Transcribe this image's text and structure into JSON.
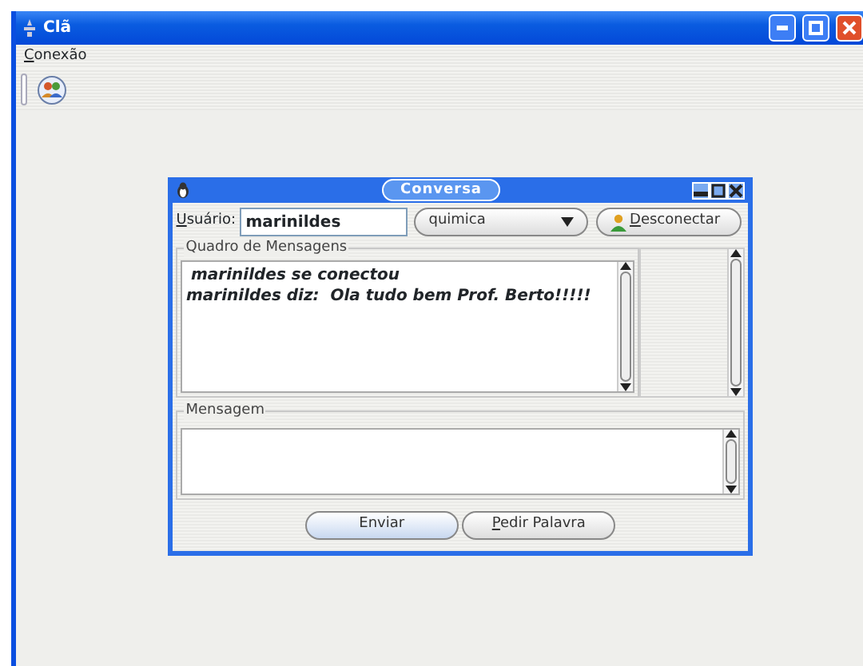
{
  "window": {
    "title": "Clã"
  },
  "menu": [
    "Conexão"
  ],
  "dialog": {
    "title": "Conversa",
    "user_label": "Usuário:",
    "user_value": "marinildes",
    "room": "quimica",
    "disconnect_button": "Desconectar",
    "messages_group": "Quadro de Mensagens",
    "messages": [
      "marinildes se conectou",
      "marinildes diz:  Ola tudo bem Prof. Berto!!!!!"
    ],
    "input_group": "Mensagem",
    "buttons": [
      "Enviar",
      "Pedir Palavra"
    ]
  }
}
